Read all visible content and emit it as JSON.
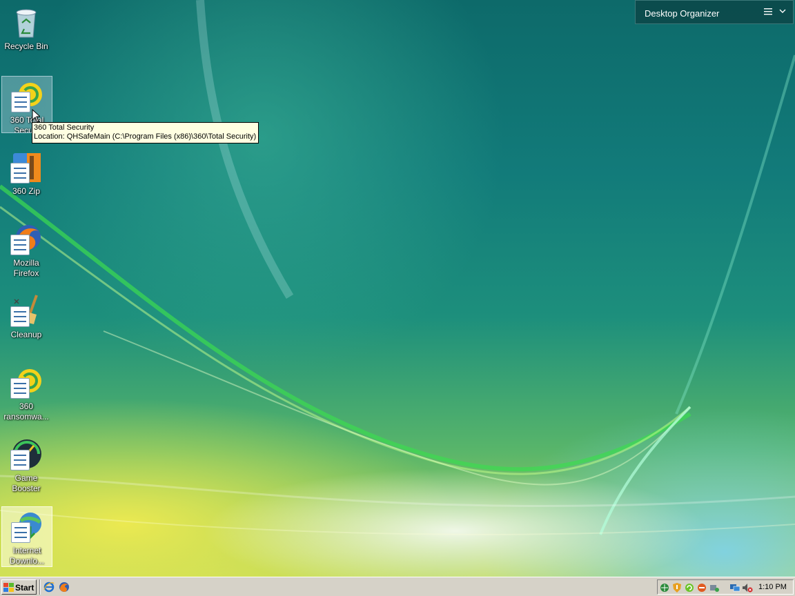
{
  "organizer": {
    "title": "Desktop Organizer"
  },
  "desktop_icons": [
    {
      "label": "Recycle Bin",
      "icon": "recycle-bin-icon"
    },
    {
      "label": "360 Total Security",
      "label_visible": "360 Total\nSecu...",
      "icon": "360-total-security-icon"
    },
    {
      "label": "360 Zip",
      "icon": "360-zip-icon"
    },
    {
      "label": "Mozilla Firefox",
      "icon": "firefox-icon"
    },
    {
      "label": "Cleanup",
      "icon": "cleanup-icon"
    },
    {
      "label": "360 ransomwa...",
      "icon": "360-ransomware-icon"
    },
    {
      "label": "Game Booster",
      "icon": "game-booster-icon"
    },
    {
      "label": "Internet Downlo...",
      "icon": "internet-download-icon"
    }
  ],
  "tooltip": {
    "line1": "360 Total Security",
    "line2": "Location: QHSafeMain (C:\\Program Files (x86)\\360\\Total Security)"
  },
  "taskbar": {
    "start_label": "Start",
    "quick_launch": [
      "internet-explorer-icon",
      "firefox-icon"
    ],
    "tray_icons": [
      "network-icon",
      "security-shield-icon",
      "update-icon",
      "block-icon",
      "device-icon",
      "network-monitor-icon",
      "volume-muted-icon"
    ],
    "clock": "1:10 PM"
  },
  "colors": {
    "taskbar": "#d6d2c8",
    "tooltip_bg": "#ffffe1",
    "organizer_bg": "#0c4648"
  }
}
